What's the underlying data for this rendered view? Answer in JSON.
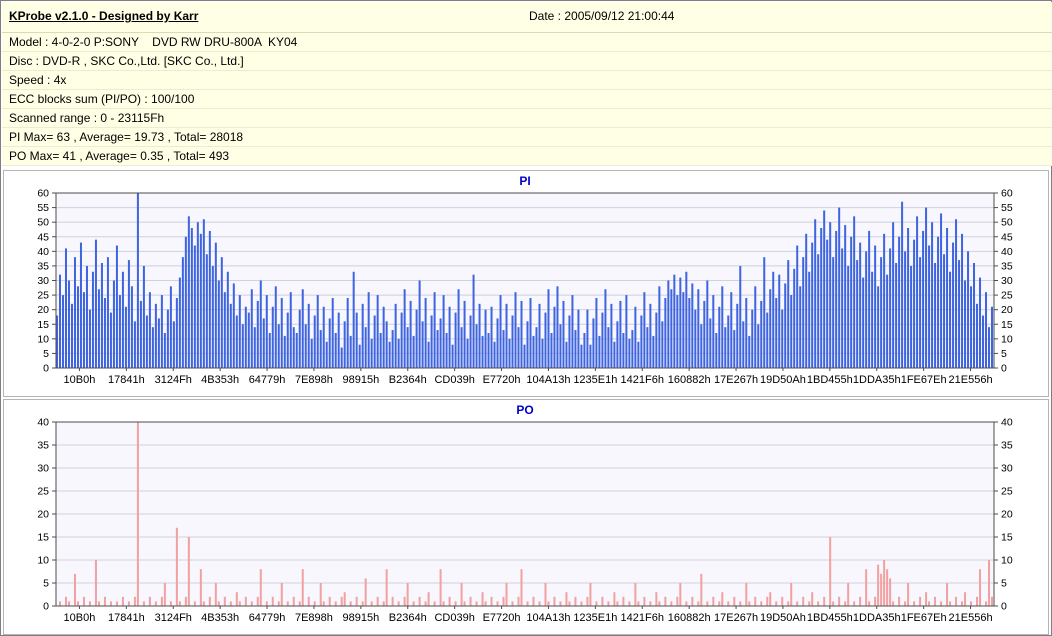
{
  "colors": {
    "header_bg": "#ffffe6",
    "pi_bar": "#3e64e0",
    "po_bar": "#f2a0a0",
    "chart_title": "#0000cc",
    "plot_bg": "#f7f7fd",
    "grid": "#d0d0e0",
    "axis": "#4d4d4d"
  },
  "header": {
    "title": "KProbe v2.1.0 - Designed by Karr",
    "date": "Date : 2005/09/12 21:00:44",
    "info_rows": [
      "Model : 4-0-2-0 P:SONY    DVD RW DRU-800A  KY04",
      "Disc : DVD-R , SKC Co.,Ltd. [SKC Co., Ltd.]",
      "Speed : 4x",
      "ECC blocks sum (PI/PO) : 100/100",
      "Scanned range : 0 - 23115Fh",
      "PI Max= 63 , Average= 19.73 , Total= 28018",
      "PO Max= 41 , Average= 0.35 , Total= 493"
    ]
  },
  "chart_data": [
    {
      "type": "bar",
      "title": "PI",
      "ylabel": "",
      "xlabel": "",
      "ylim": [
        0,
        60
      ],
      "ytick_step": 5,
      "grid": true,
      "legend": "none",
      "stats": {
        "max": 63,
        "average": 19.73,
        "total": 28018
      },
      "bar_color": "#3e64e0",
      "title_color": "#0000cc",
      "plot_bg": "#f7f7fd",
      "grid_color": "#d0d0e0",
      "axis_color": "#4d4d4d",
      "categories": [
        "10B0h",
        "17841h",
        "3124Fh",
        "4B353h",
        "64779h",
        "7E898h",
        "98915h",
        "B2364h",
        "CD039h",
        "E7720h",
        "104A13h",
        "1235E1h",
        "1421F6h",
        "160882h",
        "17E267h",
        "19D50Ah",
        "1BD455h",
        "1DDA35h",
        "1FE67Eh",
        "21E556h"
      ],
      "values": [
        18,
        32,
        25,
        41,
        30,
        22,
        38,
        28,
        43,
        26,
        35,
        20,
        33,
        44,
        27,
        36,
        24,
        38,
        19,
        30,
        42,
        25,
        33,
        21,
        37,
        28,
        16,
        63,
        23,
        35,
        18,
        26,
        14,
        22,
        17,
        25,
        12,
        20,
        28,
        16,
        24,
        31,
        38,
        45,
        52,
        48,
        42,
        50,
        46,
        51,
        39,
        47,
        35,
        43,
        30,
        38,
        26,
        33,
        22,
        29,
        18,
        25,
        15,
        21,
        19,
        27,
        14,
        23,
        30,
        17,
        25,
        12,
        21,
        28,
        15,
        24,
        11,
        19,
        26,
        14,
        12,
        20,
        27,
        15,
        22,
        10,
        18,
        25,
        13,
        21,
        9,
        17,
        24,
        12,
        19,
        7,
        16,
        24,
        11,
        33,
        19,
        8,
        22,
        14,
        26,
        10,
        18,
        25,
        12,
        21,
        16,
        9,
        13,
        22,
        10,
        19,
        27,
        14,
        23,
        11,
        20,
        30,
        16,
        24,
        9,
        18,
        26,
        13,
        17,
        25,
        12,
        21,
        8,
        19,
        27,
        14,
        23,
        10,
        18,
        32,
        15,
        22,
        11,
        20,
        12,
        21,
        9,
        17,
        25,
        13,
        22,
        10,
        18,
        26,
        14,
        23,
        8,
        16,
        24,
        11,
        14,
        22,
        10,
        19,
        27,
        12,
        21,
        28,
        15,
        23,
        9,
        18,
        25,
        13,
        20,
        8,
        12,
        20,
        8,
        17,
        24,
        11,
        19,
        27,
        14,
        22,
        9,
        16,
        23,
        12,
        25,
        10,
        13,
        21,
        9,
        18,
        26,
        14,
        22,
        11,
        19,
        28,
        16,
        24,
        30,
        27,
        32,
        25,
        31,
        26,
        33,
        24,
        29,
        20,
        27,
        15,
        23,
        30,
        17,
        25,
        12,
        21,
        28,
        14,
        18,
        26,
        13,
        22,
        35,
        16,
        24,
        11,
        20,
        28,
        15,
        23,
        38,
        19,
        27,
        33,
        24,
        32,
        20,
        29,
        37,
        25,
        34,
        42,
        28,
        38,
        46,
        33,
        43,
        51,
        39,
        48,
        54,
        44,
        50,
        38,
        47,
        55,
        41,
        49,
        35,
        45,
        52,
        37,
        43,
        31,
        40,
        47,
        33,
        42,
        28,
        38,
        46,
        32,
        41,
        50,
        36,
        45,
        57,
        40,
        48,
        35,
        44,
        52,
        38,
        47,
        55,
        42,
        50,
        36,
        45,
        53,
        39,
        48,
        33,
        43,
        51,
        37,
        46,
        30,
        40,
        28,
        36,
        22,
        31,
        18,
        26,
        14,
        21
      ]
    },
    {
      "type": "bar",
      "title": "PO",
      "ylabel": "",
      "xlabel": "",
      "ylim": [
        0,
        40
      ],
      "ytick_step": 5,
      "grid": true,
      "legend": "none",
      "stats": {
        "max": 41,
        "average": 0.35,
        "total": 493
      },
      "bar_color": "#f2a0a0",
      "title_color": "#0000cc",
      "plot_bg": "#f7f7fd",
      "grid_color": "#d0d0e0",
      "axis_color": "#4d4d4d",
      "categories": [
        "10B0h",
        "17841h",
        "3124Fh",
        "4B353h",
        "64779h",
        "7E898h",
        "98915h",
        "B2364h",
        "CD039h",
        "E7720h",
        "104A13h",
        "1235E1h",
        "1421F6h",
        "160882h",
        "17E267h",
        "19D50Ah",
        "1BD455h",
        "1DDA35h",
        "1FE67Eh",
        "21E556h"
      ],
      "values": [
        0,
        1,
        0,
        2,
        1,
        0,
        7,
        1,
        0,
        2,
        0,
        1,
        0,
        10,
        1,
        0,
        2,
        0,
        1,
        0,
        1,
        0,
        2,
        0,
        1,
        0,
        2,
        40,
        0,
        1,
        0,
        2,
        0,
        1,
        0,
        2,
        5,
        0,
        1,
        0,
        17,
        1,
        0,
        2,
        15,
        0,
        1,
        0,
        8,
        1,
        0,
        2,
        0,
        5,
        1,
        0,
        2,
        0,
        1,
        0,
        3,
        1,
        0,
        2,
        0,
        1,
        0,
        2,
        8,
        0,
        1,
        0,
        2,
        0,
        1,
        5,
        0,
        1,
        0,
        2,
        0,
        1,
        8,
        0,
        2,
        0,
        1,
        0,
        5,
        1,
        0,
        2,
        0,
        1,
        0,
        2,
        3,
        0,
        1,
        0,
        2,
        0,
        1,
        6,
        0,
        1,
        0,
        2,
        0,
        1,
        8,
        0,
        2,
        0,
        1,
        0,
        2,
        5,
        0,
        1,
        0,
        2,
        0,
        1,
        3,
        0,
        1,
        0,
        8,
        1,
        0,
        2,
        0,
        1,
        0,
        5,
        1,
        0,
        2,
        0,
        1,
        0,
        3,
        1,
        0,
        2,
        0,
        1,
        0,
        2,
        5,
        0,
        1,
        0,
        2,
        8,
        0,
        1,
        0,
        2,
        0,
        1,
        0,
        5,
        1,
        0,
        2,
        0,
        1,
        0,
        3,
        1,
        0,
        2,
        0,
        1,
        0,
        2,
        5,
        0,
        1,
        0,
        2,
        0,
        1,
        0,
        3,
        1,
        0,
        2,
        0,
        1,
        0,
        5,
        1,
        0,
        2,
        0,
        1,
        0,
        3,
        1,
        0,
        2,
        0,
        1,
        0,
        2,
        5,
        0,
        1,
        0,
        2,
        0,
        1,
        7,
        0,
        1,
        0,
        2,
        0,
        1,
        3,
        0,
        1,
        0,
        2,
        0,
        1,
        0,
        5,
        1,
        0,
        2,
        0,
        1,
        0,
        2,
        3,
        0,
        1,
        0,
        2,
        0,
        1,
        5,
        0,
        1,
        0,
        2,
        0,
        1,
        3,
        0,
        1,
        0,
        2,
        0,
        15,
        1,
        0,
        2,
        0,
        1,
        5,
        0,
        1,
        0,
        2,
        0,
        8,
        1,
        0,
        2,
        9,
        7,
        10,
        8,
        6,
        1,
        0,
        2,
        0,
        1,
        5,
        0,
        1,
        0,
        2,
        0,
        3,
        1,
        0,
        2,
        0,
        1,
        0,
        5,
        1,
        0,
        2,
        0,
        1,
        3,
        0,
        1,
        0,
        2,
        8,
        0,
        1,
        10,
        2
      ]
    }
  ]
}
